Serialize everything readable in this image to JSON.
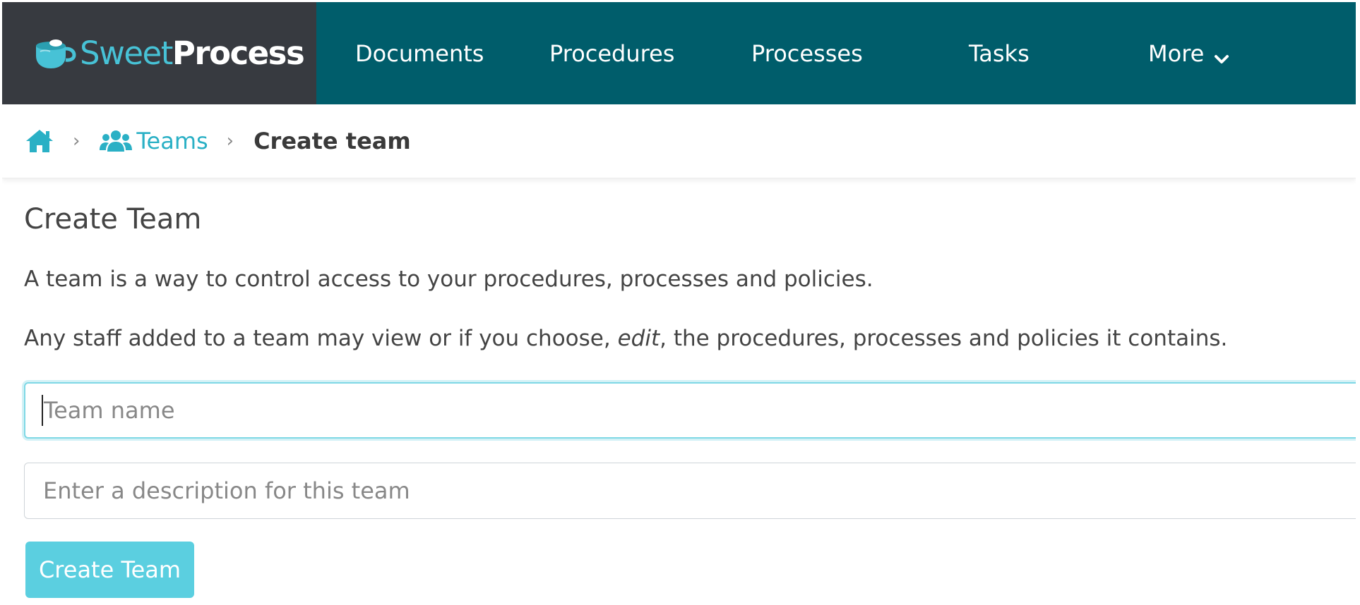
{
  "brand": {
    "name_part1": "Sweet",
    "name_part2": "Process",
    "logo_icon": "coffee-cup-icon"
  },
  "nav": {
    "items": [
      {
        "label": "Documents"
      },
      {
        "label": "Procedures"
      },
      {
        "label": "Processes"
      },
      {
        "label": "Tasks"
      },
      {
        "label": "More",
        "icon": "chevron-down-icon"
      }
    ]
  },
  "breadcrumb": {
    "home_icon": "home-icon",
    "teams_icon": "users-icon",
    "teams_label": "Teams",
    "separator": "›",
    "current": "Create team"
  },
  "form": {
    "title": "Create Team",
    "description_1": "A team is a way to control access to your procedures, processes and policies.",
    "description_2_before": "Any staff added to a team may view or if you choose, ",
    "description_2_emphasis": "edit",
    "description_2_after": ", the procedures, processes and policies it contains.",
    "team_name": {
      "value": "",
      "placeholder": "Team name"
    },
    "team_description": {
      "value": "",
      "placeholder": "Enter a description for this team"
    },
    "submit_label": "Create Team"
  },
  "colors": {
    "nav_bg": "#005d6b",
    "brand_bg": "#373a40",
    "accent": "#2ab0c5",
    "button": "#5bcfe0"
  }
}
